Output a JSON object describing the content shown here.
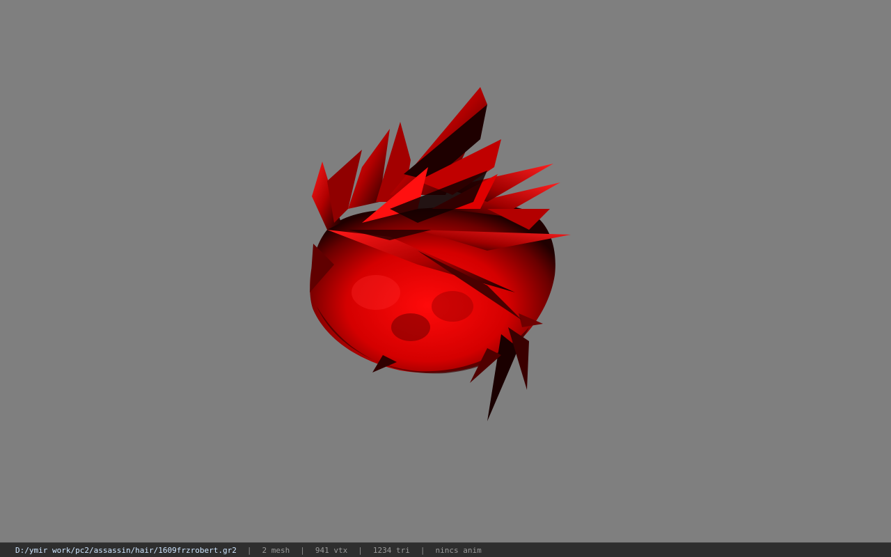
{
  "viewer": {
    "background_color": "#7f7f7f",
    "model_color": "#e60000"
  },
  "statusbar": {
    "path": "D:/ymir work/pc2/assassin/hair/1609frzrobert.gr2",
    "separator": "|",
    "mesh": "2 mesh",
    "vtx": "941 vtx",
    "tri": "1234 tri",
    "anim": "nincs anim"
  }
}
